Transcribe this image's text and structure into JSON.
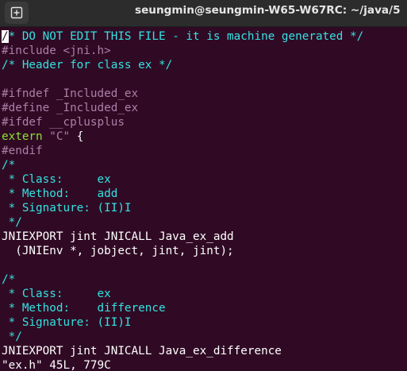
{
  "window": {
    "title": "seungmin@seungmin-W65-W67RC: ~/java/5",
    "new_tab_icon": "new-tab-icon"
  },
  "editor": {
    "lines": [
      {
        "type": "comment-cursor",
        "cursor": "/",
        "text": "* DO NOT EDIT THIS FILE - it is machine generated */"
      },
      {
        "type": "include",
        "a": "#include ",
        "b": "<jni.h>"
      },
      {
        "type": "comment",
        "text": "/* Header for class ex */"
      },
      {
        "type": "blank",
        "text": ""
      },
      {
        "type": "pre",
        "text": "#ifndef _Included_ex"
      },
      {
        "type": "pre",
        "text": "#define _Included_ex"
      },
      {
        "type": "pre",
        "text": "#ifdef __cplusplus"
      },
      {
        "type": "extern",
        "a": "extern ",
        "b": "\"C\"",
        "c": " {"
      },
      {
        "type": "pre",
        "text": "#endif"
      },
      {
        "type": "comment",
        "text": "/*"
      },
      {
        "type": "comment",
        "text": " * Class:     ex"
      },
      {
        "type": "comment",
        "text": " * Method:    add"
      },
      {
        "type": "comment",
        "text": " * Signature: (II)I"
      },
      {
        "type": "comment",
        "text": " */"
      },
      {
        "type": "text",
        "text": "JNIEXPORT jint JNICALL Java_ex_add"
      },
      {
        "type": "text",
        "text": "  (JNIEnv *, jobject, jint, jint);"
      },
      {
        "type": "blank",
        "text": ""
      },
      {
        "type": "comment",
        "text": "/*"
      },
      {
        "type": "comment",
        "text": " * Class:     ex"
      },
      {
        "type": "comment",
        "text": " * Method:    difference"
      },
      {
        "type": "comment",
        "text": " * Signature: (II)I"
      },
      {
        "type": "comment",
        "text": " */"
      },
      {
        "type": "text",
        "text": "JNIEXPORT jint JNICALL Java_ex_difference"
      },
      {
        "type": "status",
        "text": "\"ex.h\" 45L, 779C"
      }
    ]
  },
  "colors": {
    "background": "#300a24",
    "comment": "#34e2e2",
    "preprocessor": "#ad7fa8",
    "keyword": "#8ae234",
    "text": "#ffffff"
  }
}
